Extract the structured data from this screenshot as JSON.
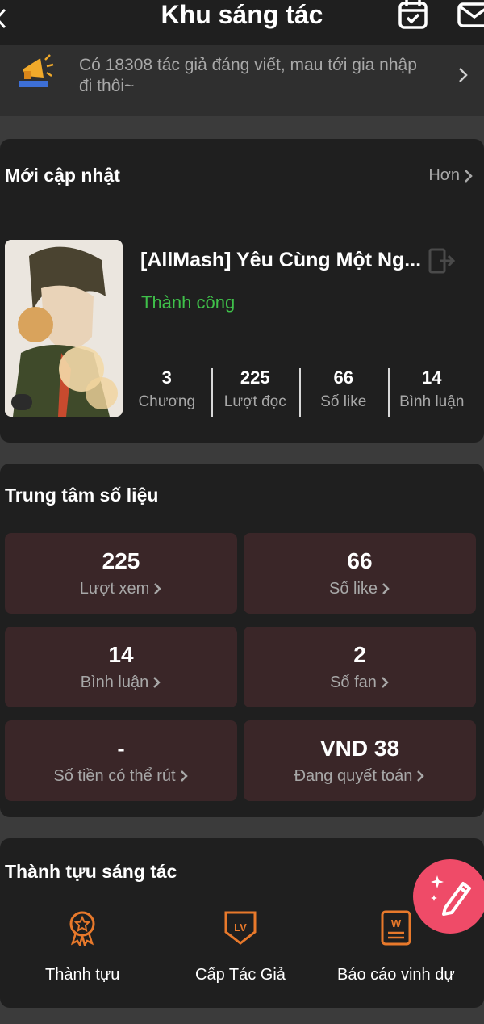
{
  "header": {
    "title": "Khu sáng tác",
    "icons": [
      "back-icon",
      "calendar-icon",
      "mail-icon"
    ]
  },
  "notice": {
    "text": "Có 18308 tác giả đáng viết, mau tới gia nhập đi thôi~",
    "icon": "megaphone-icon"
  },
  "updates": {
    "title": "Mới cập nhật",
    "more_label": "Hơn",
    "book": {
      "title": "[AllMash] Yêu Cùng Một Ng...",
      "status": "Thành công",
      "stats": [
        {
          "value": "3",
          "label": "Chương"
        },
        {
          "value": "225",
          "label": "Lượt đọc"
        },
        {
          "value": "66",
          "label": "Số like"
        },
        {
          "value": "14",
          "label": "Bình luận"
        }
      ]
    }
  },
  "stats_center": {
    "title": "Trung tâm số liệu",
    "tiles": [
      {
        "value": "225",
        "label": "Lượt xem"
      },
      {
        "value": "66",
        "label": "Số like"
      },
      {
        "value": "14",
        "label": "Bình luận"
      },
      {
        "value": "2",
        "label": "Số fan"
      },
      {
        "value": "-",
        "label": "Số tiền có thể rút"
      },
      {
        "value": "VND 38",
        "label": "Đang quyết toán"
      }
    ]
  },
  "achievements": {
    "title": "Thành tựu sáng tác",
    "items": [
      {
        "label": "Thành tựu",
        "icon": "medal-icon"
      },
      {
        "label": "Cấp Tác Giả",
        "icon": "level-badge-icon"
      },
      {
        "label": "Báo cáo vinh dự",
        "icon": "honor-report-icon"
      }
    ]
  },
  "colors": {
    "background": "#3b3b3b",
    "card": "#1f1f1f",
    "tile": "#3a2628",
    "success": "#3fc04a",
    "accent_orange": "#e8792b",
    "fab": "#ef4b68",
    "muted_text": "#a8a8a8"
  }
}
